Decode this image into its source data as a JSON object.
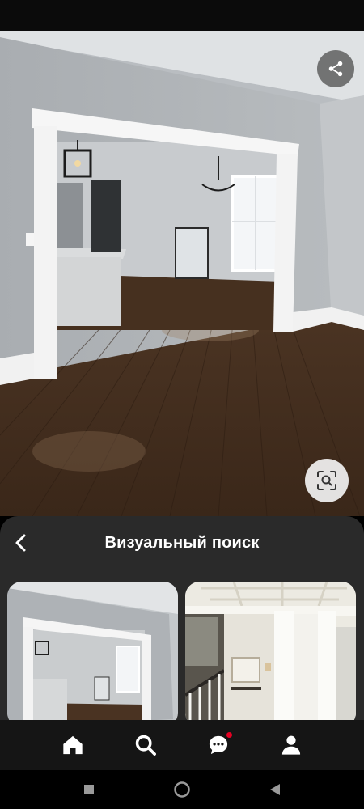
{
  "status_bar": {},
  "main_image": {
    "alt_name": "room-photo"
  },
  "icons": {
    "share": "share-icon",
    "visual_search": "visual-search-icon",
    "back": "chevron-left-icon",
    "home": "home-icon",
    "search": "search-icon",
    "messages": "chat-bubble-icon",
    "profile": "person-icon"
  },
  "sheet": {
    "title": "Визуальный поиск"
  },
  "results": [
    {
      "name": "result-room-open-doorway"
    },
    {
      "name": "result-coffered-ceiling-staircase"
    }
  ],
  "nav": {
    "has_notification": true
  },
  "colors": {
    "sheet_bg": "#2a2a2a",
    "nav_bg": "#151515",
    "notification": "#e60023"
  }
}
